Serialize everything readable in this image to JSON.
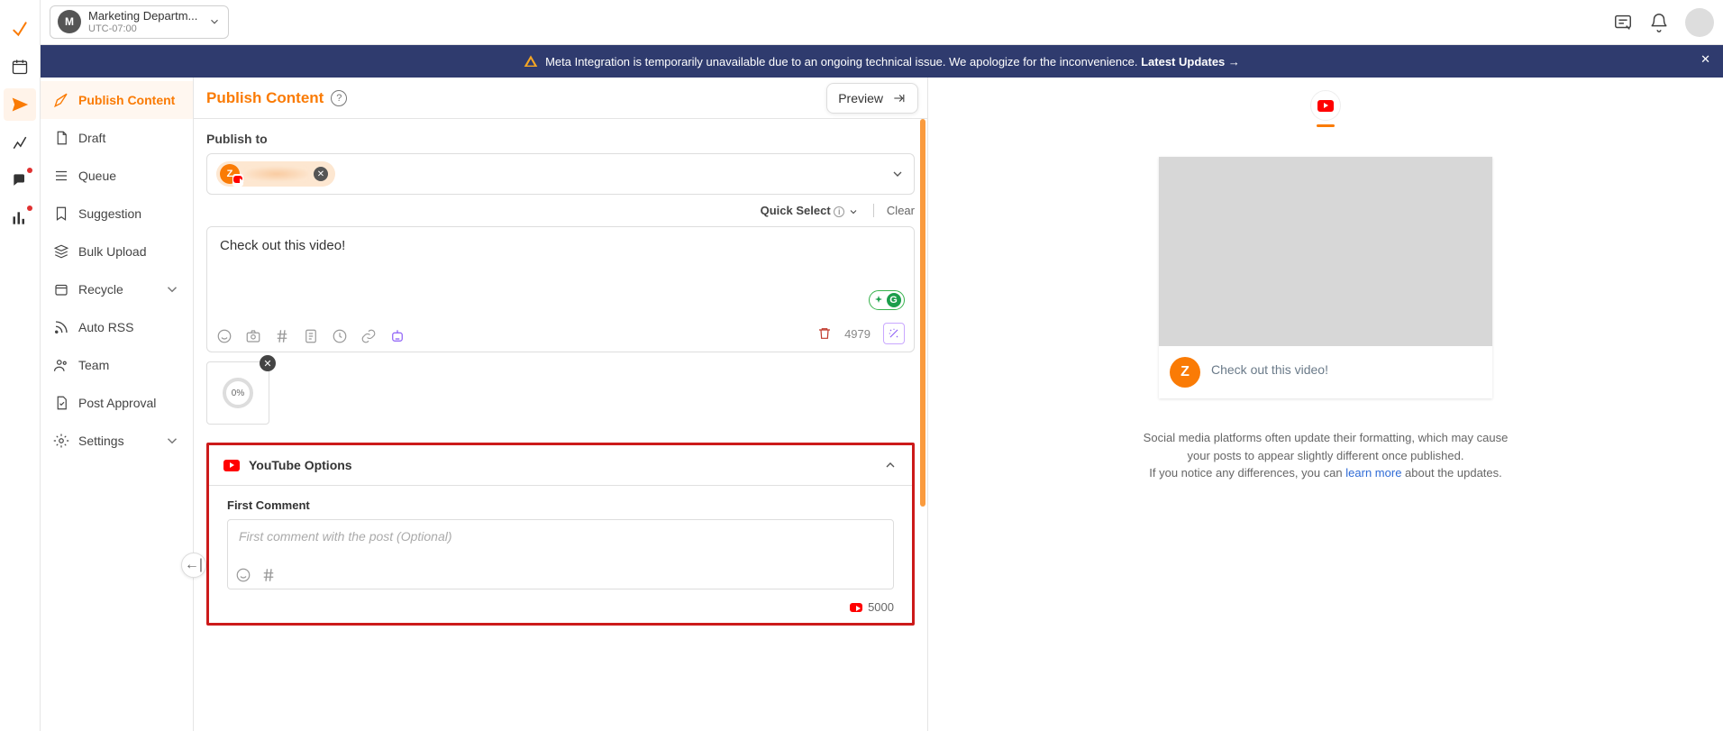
{
  "org": {
    "avatar_letter": "M",
    "name": "Marketing Departm...",
    "timezone": "UTC-07:00"
  },
  "banner": {
    "text_pre": "Meta Integration is temporarily unavailable due to an ongoing technical issue. We apologize for the inconvenience.",
    "link_label": "Latest Updates"
  },
  "sidebar": {
    "publish_content": "Publish Content",
    "draft": "Draft",
    "queue": "Queue",
    "suggestion": "Suggestion",
    "bulk_upload": "Bulk Upload",
    "recycle": "Recycle",
    "auto_rss": "Auto RSS",
    "team": "Team",
    "post_approval": "Post Approval",
    "settings": "Settings"
  },
  "center": {
    "title": "Publish Content",
    "preview_label": "Preview",
    "publish_to_label": "Publish to",
    "channel_letter": "Z",
    "quick_select": "Quick Select",
    "clear": "Clear",
    "compose_text": "Check out this video!",
    "grammarly": "G",
    "char_remaining": "4979",
    "upload_pct": "0%",
    "youtube_options": "YouTube Options",
    "first_comment_label": "First Comment",
    "first_comment_placeholder": "First comment with the post (Optional)",
    "first_comment_limit": "5000"
  },
  "preview": {
    "avatar_letter": "Z",
    "post_text": "Check out this video!",
    "note_line1": "Social media platforms often update their formatting, which may cause your posts to appear slightly different once published.",
    "note_line2_pre": "If you notice any differences, you can",
    "learn_more": "learn more",
    "note_line2_post": "about the updates."
  }
}
